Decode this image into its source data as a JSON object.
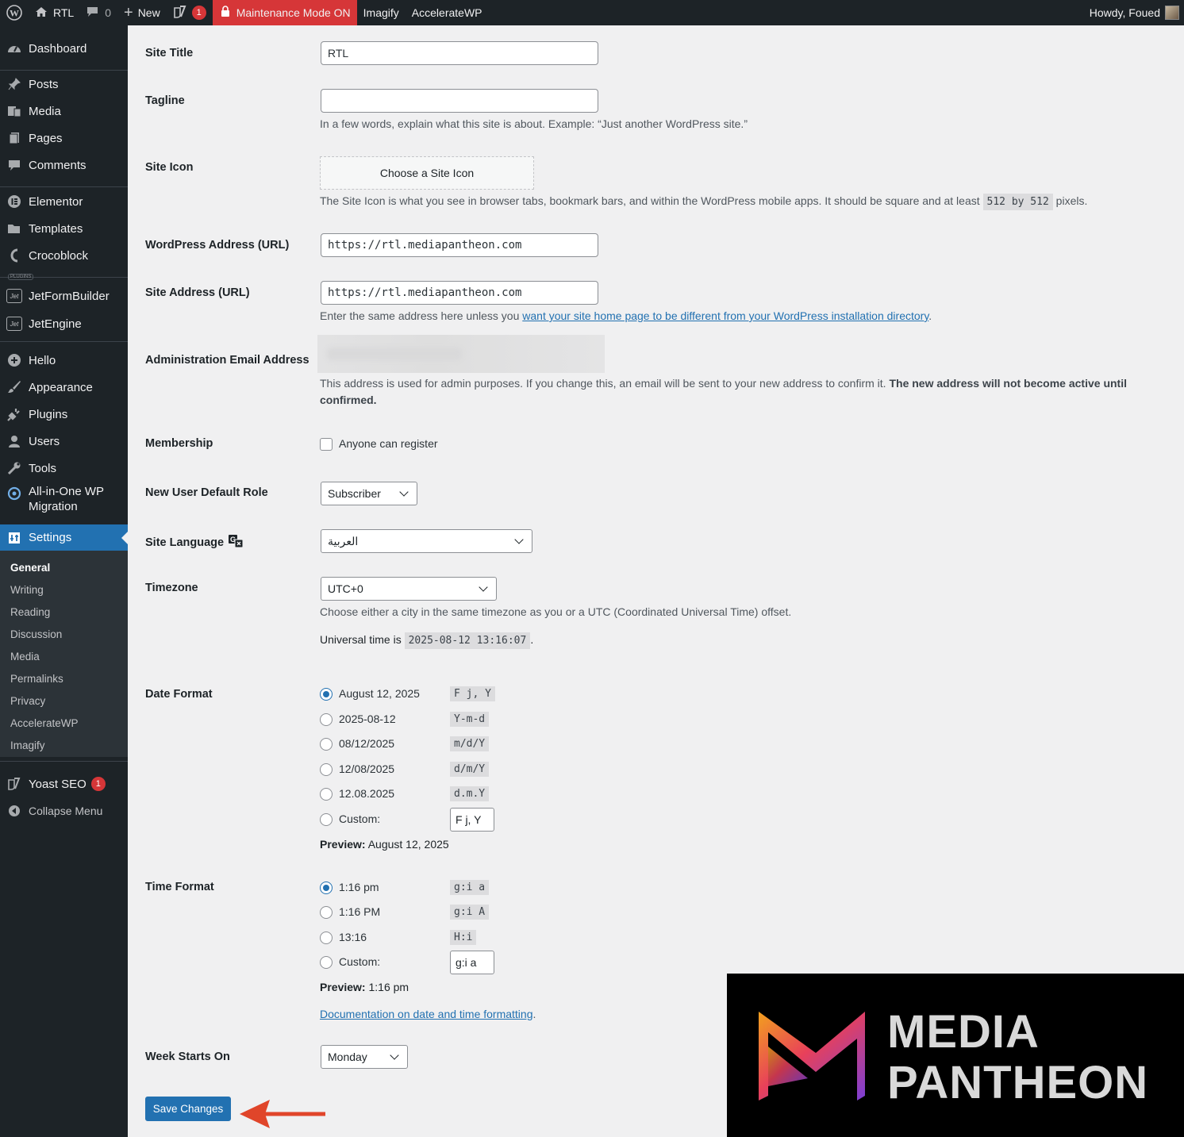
{
  "adminbar": {
    "site_name": "RTL",
    "comments_count": "0",
    "new_label": "New",
    "yoast_count": "1",
    "maintenance_label": "Maintenance Mode ON",
    "imagify_label": "Imagify",
    "acceleratewp_label": "AccelerateWP",
    "howdy": "Howdy, Foued"
  },
  "sidebar": {
    "items": [
      {
        "label": "Dashboard",
        "icon": "dashboard-icon"
      },
      {
        "label": "Posts",
        "icon": "pin-icon"
      },
      {
        "label": "Media",
        "icon": "media-icon"
      },
      {
        "label": "Pages",
        "icon": "pages-icon"
      },
      {
        "label": "Comments",
        "icon": "comment-icon"
      },
      {
        "label": "Elementor",
        "icon": "elementor-icon"
      },
      {
        "label": "Templates",
        "icon": "folder-icon"
      },
      {
        "label": "Crocoblock",
        "icon": "crocoblock-icon"
      },
      {
        "label": "JetFormBuilder",
        "icon": "jet-icon"
      },
      {
        "label": "JetEngine",
        "icon": "jet-icon"
      },
      {
        "label": "Hello",
        "icon": "plus-circle-icon"
      },
      {
        "label": "Appearance",
        "icon": "brush-icon"
      },
      {
        "label": "Plugins",
        "icon": "plug-icon"
      },
      {
        "label": "Users",
        "icon": "user-icon"
      },
      {
        "label": "Tools",
        "icon": "wrench-icon"
      },
      {
        "label": "All-in-One WP Migration",
        "line1": "All-in-One WP",
        "line2": "Migration",
        "icon": "migration-icon"
      },
      {
        "label": "Settings",
        "icon": "settings-icon"
      },
      {
        "label": "Yoast SEO",
        "icon": "yoast-icon",
        "badge": "1"
      },
      {
        "label": "Collapse Menu",
        "icon": "collapse-icon"
      }
    ],
    "plugins_tag": "PLUGINS",
    "jet_tag": "Jet",
    "submenu": [
      "General",
      "Writing",
      "Reading",
      "Discussion",
      "Media",
      "Permalinks",
      "Privacy",
      "AccelerateWP",
      "Imagify"
    ]
  },
  "form": {
    "site_title": {
      "label": "Site Title",
      "value": "RTL"
    },
    "tagline": {
      "label": "Tagline",
      "value": "",
      "description": "In a few words, explain what this site is about. Example: “Just another WordPress site.”"
    },
    "site_icon": {
      "label": "Site Icon",
      "button": "Choose a Site Icon",
      "desc_before": "The Site Icon is what you see in browser tabs, bookmark bars, and within the WordPress mobile apps. It should be square and at least ",
      "desc_code": "512 by 512",
      "desc_after": " pixels."
    },
    "wp_address": {
      "label": "WordPress Address (URL)",
      "value": "https://rtl.mediapantheon.com"
    },
    "site_address": {
      "label": "Site Address (URL)",
      "value": "https://rtl.mediapantheon.com",
      "desc_before": "Enter the same address here unless you ",
      "desc_link": "want your site home page to be different from your WordPress installation directory",
      "desc_after": "."
    },
    "admin_email": {
      "label": "Administration Email Address",
      "desc_normal": "This address is used for admin purposes. If you change this, an email will be sent to your new address to confirm it. ",
      "desc_bold": "The new address will not become active until confirmed."
    },
    "membership": {
      "label": "Membership",
      "checkbox_label": "Anyone can register",
      "checked": false
    },
    "default_role": {
      "label": "New User Default Role",
      "value": "Subscriber"
    },
    "site_language": {
      "label": "Site Language",
      "value": "العربية",
      "icon": "translate-icon"
    },
    "timezone": {
      "label": "Timezone",
      "value": "UTC+0",
      "description": "Choose either a city in the same timezone as you or a UTC (Coordinated Universal Time) offset.",
      "universal_label": "Universal time is ",
      "universal_time": "2025-08-12 13:16:07",
      "universal_after": "."
    },
    "date_format": {
      "label": "Date Format",
      "options": [
        {
          "text": "August 12, 2025",
          "code": "F j, Y",
          "selected": true
        },
        {
          "text": "2025-08-12",
          "code": "Y-m-d",
          "selected": false
        },
        {
          "text": "08/12/2025",
          "code": "m/d/Y",
          "selected": false
        },
        {
          "text": "12/08/2025",
          "code": "d/m/Y",
          "selected": false
        },
        {
          "text": "12.08.2025",
          "code": "d.m.Y",
          "selected": false
        }
      ],
      "custom_label": "Custom:",
      "custom_value": "F j, Y",
      "preview_label": "Preview:",
      "preview_value": " August 12, 2025"
    },
    "time_format": {
      "label": "Time Format",
      "options": [
        {
          "text": "1:16 pm",
          "code": "g:i a",
          "selected": true
        },
        {
          "text": "1:16 PM",
          "code": "g:i A",
          "selected": false
        },
        {
          "text": "13:16",
          "code": "H:i",
          "selected": false
        }
      ],
      "custom_label": "Custom:",
      "custom_value": "g:i a",
      "preview_label": "Preview:",
      "preview_value": " 1:16 pm",
      "doc_link": "Documentation on date and time formatting",
      "doc_after": "."
    },
    "week_starts": {
      "label": "Week Starts On",
      "value": "Monday"
    },
    "save_button": "Save Changes"
  },
  "overlay_logo": {
    "line1": "MEDIA",
    "line2": "PANTHEON"
  },
  "colors": {
    "accent": "#2271b1",
    "adminbar": "#1d2327",
    "maintenance": "#d63638",
    "arrow": "#e0452a"
  }
}
